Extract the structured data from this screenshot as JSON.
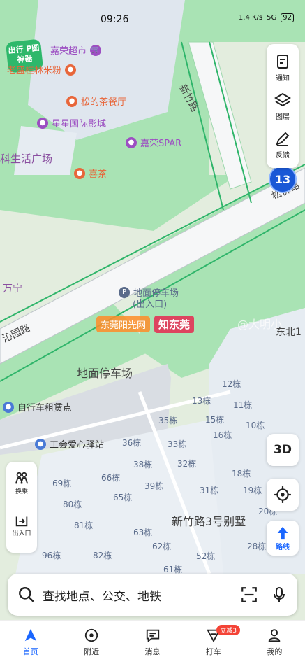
{
  "status_bar": {
    "time": "09:26",
    "net_speed": "1.4 K/s",
    "signal": "5G",
    "battery": "92"
  },
  "map": {
    "logo_text": "出行 P图神器",
    "pois": [
      {
        "name": "嘉荣超市",
        "icon": "shopping-cart-icon",
        "color": "#9c4fc2"
      },
      {
        "name": "老盛桂林米粉",
        "icon": "food-icon",
        "color": "#e8663a"
      },
      {
        "name": "松的茶餐厅",
        "icon": "food-icon",
        "color": "#e8663a"
      },
      {
        "name": "星星国际影城",
        "icon": "film-icon",
        "color": "#9c4fc2"
      },
      {
        "name": "嘉荣SPAR",
        "icon": "shopping-cart-icon",
        "color": "#9c4fc2"
      },
      {
        "name": "喜茶",
        "icon": "food-icon",
        "color": "#e8663a"
      },
      {
        "name": "地面停车场",
        "icon": "parking-icon",
        "color": "#5a6b8a"
      },
      {
        "name": "(出入口)",
        "icon": "",
        "color": "#5a6b8a"
      },
      {
        "name": "自行车租赁点",
        "icon": "pin-icon",
        "color": "#4a7ad6"
      },
      {
        "name": "工会爱心驿站",
        "icon": "pin-icon",
        "color": "#4a7ad6"
      }
    ],
    "area_labels": [
      "科生活广场",
      "万宁",
      "地面停车场",
      "新竹路3号别墅",
      "东北1"
    ],
    "road_labels": [
      "新竹路",
      "松佛路",
      "沁园路"
    ],
    "route_shield": "13",
    "buildings": [
      "12栋",
      "13栋",
      "11栋",
      "15栋",
      "10栋",
      "35栋",
      "16栋",
      "36栋",
      "33栋",
      "38栋",
      "32栋",
      "66栋",
      "69栋",
      "39栋",
      "31栋",
      "18栋",
      "19栋",
      "65栋",
      "80栋",
      "81栋",
      "63栋",
      "20栋",
      "82栋",
      "96栋",
      "62栋",
      "52栋",
      "28栋",
      "61栋"
    ],
    "watermarks": {
      "site1": "东莞阳光网",
      "site2": "知东莞",
      "author": "@大明小"
    }
  },
  "right_panel": {
    "notify": "通知",
    "layers": "图层",
    "feedback": "反馈"
  },
  "controls": {
    "three_d": "3D",
    "route": "路线",
    "left_top": "换乘",
    "left_bottom": "出入口"
  },
  "search": {
    "placeholder": "查找地点、公交、地铁"
  },
  "tabs": [
    {
      "label": "首页"
    },
    {
      "label": "附近"
    },
    {
      "label": "消息"
    },
    {
      "label": "打车",
      "badge": "立减3"
    },
    {
      "label": "我的"
    }
  ]
}
